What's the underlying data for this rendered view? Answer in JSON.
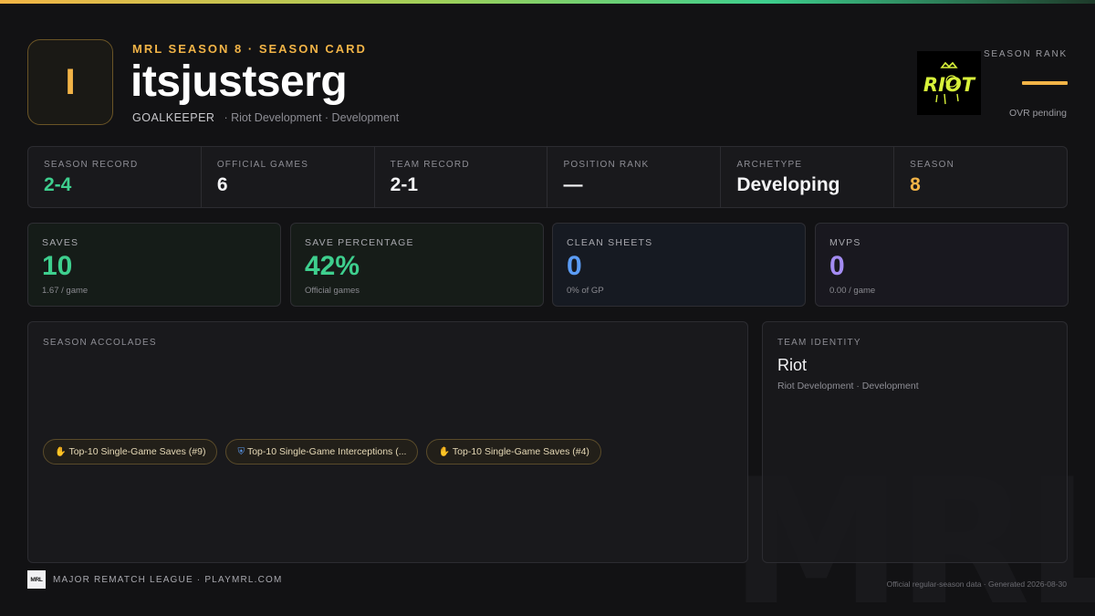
{
  "header": {
    "initial": "I",
    "kicker": "MRL SEASON 8 · SEASON CARD",
    "player_name": "itsjustserg",
    "position": "GOALKEEPER",
    "team_line": "· Riot Development · Development"
  },
  "rank": {
    "label": "SEASON RANK",
    "value": "—",
    "subtext": "OVR pending",
    "team_logo_text": "RIOT"
  },
  "stats_row": [
    {
      "label": "Season Record",
      "value": "2-4",
      "color": "#3ecf8e"
    },
    {
      "label": "Official Games",
      "value": "6",
      "color": "#f3f3f5"
    },
    {
      "label": "Team Record",
      "value": "2-1",
      "color": "#f3f3f5"
    },
    {
      "label": "Position Rank",
      "value": "—",
      "color": "#f3f3f5"
    },
    {
      "label": "Archetype",
      "value": "Developing",
      "color": "#f3f3f5"
    },
    {
      "label": "Season",
      "value": "8",
      "color": "#f2b447"
    }
  ],
  "big_stats": [
    {
      "label": "SAVES",
      "value": "10",
      "sub": "1.67 / game",
      "color": "#3ecf8e"
    },
    {
      "label": "SAVE PERCENTAGE",
      "value": "42%",
      "sub": "Official games",
      "color": "#3ecf8e"
    },
    {
      "label": "CLEAN SHEETS",
      "value": "0",
      "sub": "0% of GP",
      "color": "#5b9cf5"
    },
    {
      "label": "MVPS",
      "value": "0",
      "sub": "0.00 / game",
      "color": "#a48cf2"
    }
  ],
  "accolades": {
    "label": "SEASON ACCOLADES",
    "items": [
      {
        "icon": "glove-icon",
        "text": "Top-10 Single-Game Saves (#9)"
      },
      {
        "icon": "shield-icon",
        "text": "Top-10 Single-Game Interceptions (..."
      },
      {
        "icon": "glove-icon",
        "text": "Top-10 Single-Game Saves (#4)"
      }
    ]
  },
  "team_identity": {
    "label": "TEAM IDENTITY",
    "name": "Riot",
    "sub": "Riot Development · Development"
  },
  "footer": {
    "logo_text": "MRL",
    "left": "MAJOR REMATCH LEAGUE · PLAYMRL.COM",
    "right": "Official regular-season data · Generated 2026-08-30"
  },
  "watermark": "MRL"
}
